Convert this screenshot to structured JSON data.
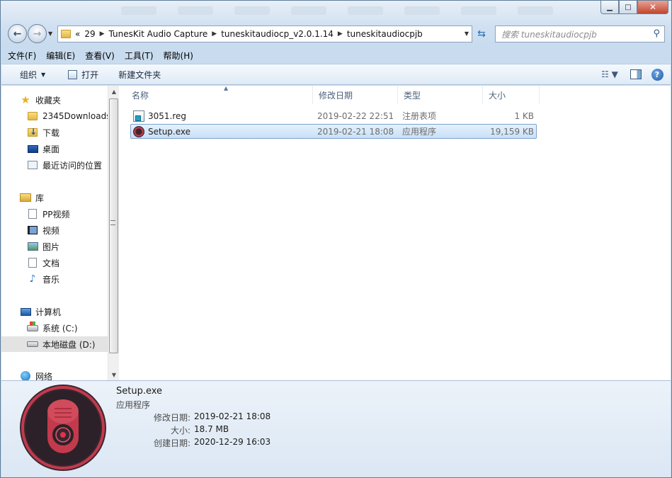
{
  "window": {
    "controls": {
      "minimize": "▁",
      "maximize": "□",
      "close": "✕"
    }
  },
  "address_bar": {
    "overflow": "«",
    "segments": [
      "29",
      "TunesKit Audio Capture",
      "tuneskitaudiocp_v2.0.1.14",
      "tuneskitaudiocpjb"
    ]
  },
  "search": {
    "placeholder": "搜索 tuneskitaudiocpjb"
  },
  "menu": [
    "文件(F)",
    "编辑(E)",
    "查看(V)",
    "工具(T)",
    "帮助(H)"
  ],
  "toolbar": {
    "organize": "组织",
    "open": "打开",
    "new_folder": "新建文件夹"
  },
  "nav": {
    "favorites": "收藏夹",
    "downloads_2345": "2345Downloads",
    "downloads": "下载",
    "desktop": "桌面",
    "recent": "最近访问的位置",
    "libraries": "库",
    "pp_video": "PP视频",
    "videos": "视频",
    "pictures": "图片",
    "documents": "文档",
    "music": "音乐",
    "computer": "计算机",
    "drive_c": "系统 (C:)",
    "drive_d": "本地磁盘 (D:)",
    "network": "网络"
  },
  "columns": {
    "name": "名称",
    "modified": "修改日期",
    "type": "类型",
    "size": "大小"
  },
  "files": [
    {
      "name": "3051.reg",
      "modified": "2019-02-22 22:51",
      "type": "注册表项",
      "size": "1 KB",
      "icon": "registry-file-icon"
    },
    {
      "name": "Setup.exe",
      "modified": "2019-02-21 18:08",
      "type": "应用程序",
      "size": "19,159 KB",
      "icon": "tuneskit-app-icon"
    }
  ],
  "details": {
    "name": "Setup.exe",
    "type": "应用程序",
    "modified_label": "修改日期:",
    "modified": "2019-02-21 18:08",
    "size_label": "大小:",
    "size": "18.7 MB",
    "created_label": "创建日期:",
    "created": "2020-12-29 16:03"
  },
  "colors": {
    "selection": "#cce4f7",
    "accent": "#c23a4b",
    "chrome": "#d5e3f1"
  }
}
